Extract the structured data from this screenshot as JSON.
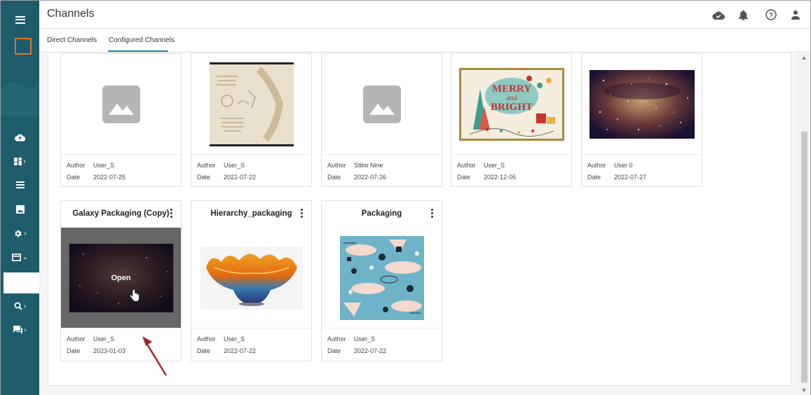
{
  "header": {
    "title": "Channels",
    "icons": [
      "cloud-check-icon",
      "bell-icon",
      "help-icon",
      "user-icon"
    ]
  },
  "tabs": [
    {
      "label": "Direct Channels",
      "active": false
    },
    {
      "label": "Configured Channels",
      "active": true
    }
  ],
  "sidebar": {
    "icons": [
      "menu-icon",
      "logo-square",
      "cloud-upload-icon",
      "dashboard-icon",
      "list-icon",
      "image-icon",
      "settings-icon",
      "card-icon",
      "search-icon",
      "chat-icon"
    ]
  },
  "labels": {
    "author": "Author",
    "date": "Date",
    "open": "Open"
  },
  "row1": [
    {
      "author": "User_S",
      "date": "2022-07-25",
      "image": "placeholder"
    },
    {
      "author": "User_S",
      "date": "2022-07-22",
      "image": "sketch"
    },
    {
      "author": "Stibo Nine",
      "date": "2022-07-26",
      "image": "placeholder"
    },
    {
      "author": "User_S",
      "date": "2022-12-05",
      "image": "merry-and-bright"
    },
    {
      "author": "User 0",
      "date": "2022-07-27",
      "image": "galaxy"
    }
  ],
  "row2": [
    {
      "title": "Galaxy Packaging (Copy)",
      "author": "User_S",
      "date": "2023-01-03",
      "image": "galaxy",
      "hovered": true
    },
    {
      "title": "Hierarchy_packaging",
      "author": "User_S",
      "date": "2022-07-22",
      "image": "glass-bowl"
    },
    {
      "title": "Packaging",
      "author": "User_S",
      "date": "2022-07-22",
      "image": "retro-pattern"
    }
  ],
  "colors": {
    "sidebar": "#1e5b6b",
    "accent": "#1e8aa6",
    "logo": "#e0742c",
    "arrow": "#a0282a"
  }
}
